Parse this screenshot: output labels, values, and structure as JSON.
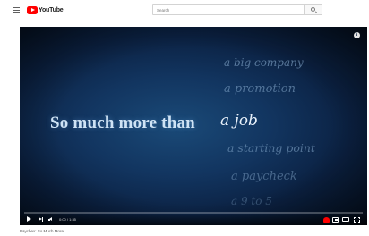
{
  "header": {
    "logo_text": "YouTube",
    "search_placeholder": "Search"
  },
  "video": {
    "headline": "So much more than",
    "headline_script": "a job",
    "background_words": [
      "a big company",
      "a promotion",
      "a starting point",
      "a paycheck",
      "a 9 to 5"
    ],
    "progress_fraction": 0.0,
    "time_display": "0:00 / 1:35",
    "colors": {
      "progress_red": "#ff0000",
      "background_navy": "#0b2142"
    }
  },
  "title": "Paychex: So Much More"
}
